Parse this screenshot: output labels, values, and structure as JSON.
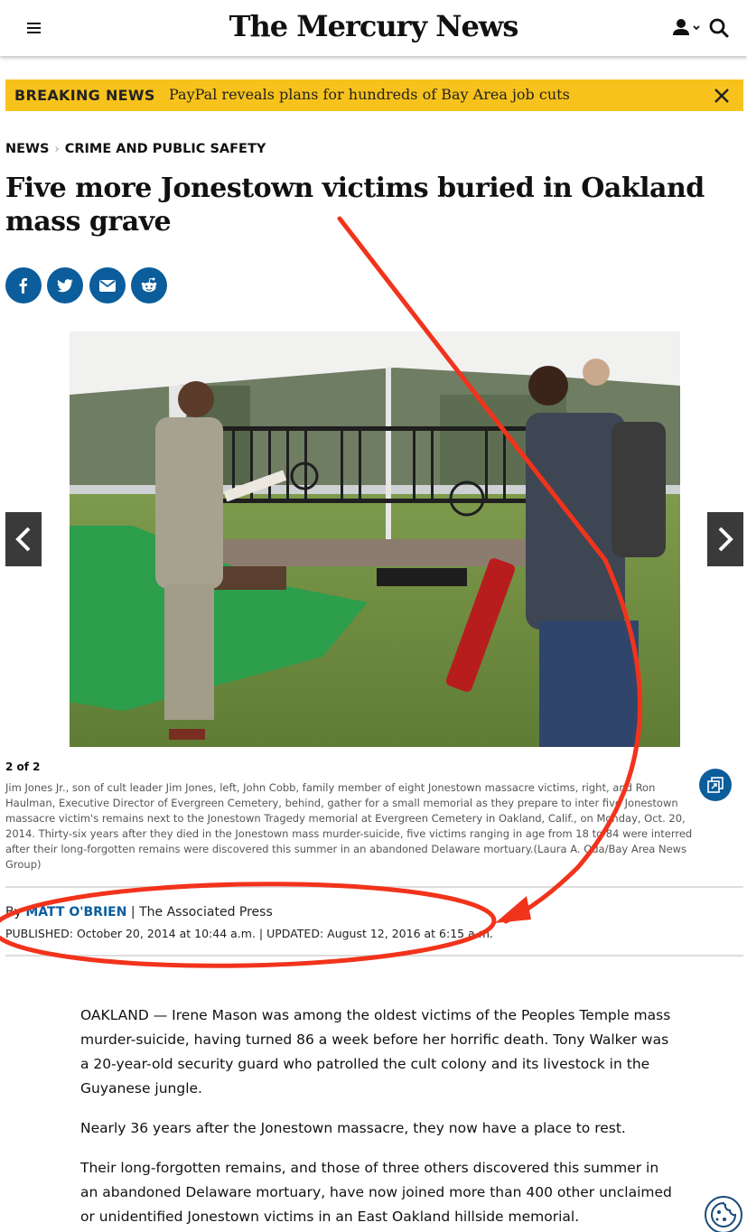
{
  "header": {
    "logo": "The Mercury News"
  },
  "breaking": {
    "label": "BREAKING NEWS",
    "text": "PayPal reveals plans for hundreds of Bay Area job cuts",
    "color": "#f7c21b"
  },
  "breadcrumb": {
    "items": [
      "NEWS",
      "CRIME AND PUBLIC SAFETY"
    ]
  },
  "article": {
    "headline": "Five more Jonestown victims buried in Oakland mass grave",
    "share_icons": [
      "facebook-icon",
      "twitter-icon",
      "email-icon",
      "reddit-icon"
    ],
    "gallery": {
      "counter": "2 of 2",
      "caption": "Jim Jones Jr., son of cult leader Jim Jones, left, John Cobb, family member of eight Jonestown massacre victims, right, and Ron Haulman, Executive Director of Evergreen Cemetery, behind, gather for a small memorial as they prepare to inter five Jonestown massacre victim's remains next to the Jonestown Tragedy memorial at Evergreen Cemetery in Oakland, Calif., on Monday, Oct. 20, 2014. Thirty-six years after they died in the Jonestown mass murder-suicide, five victims ranging in age from 18 to 84 were interred after their long-forgotten remains were discovered this summer in an abandoned Delaware mortuary.(Laura A. Oda/Bay Area News Group)"
    },
    "byline": {
      "prefix": "By",
      "author": "MATT O'BRIEN",
      "separator": "|",
      "org": "The Associated Press"
    },
    "dates": {
      "published_label": "PUBLISHED:",
      "published": "October 20, 2014 at 10:44 a.m.",
      "separator": "|",
      "updated_label": "UPDATED:",
      "updated": "August 12, 2016 at 6:15 a.m."
    },
    "paragraphs": [
      "OAKLAND — Irene Mason was among the oldest victims of the Peoples Temple mass murder-suicide, having turned 86 a week before her horrific death. Tony Walker was a 20-year-old security guard who patrolled the cult colony and its livestock in the Guyanese jungle.",
      "Nearly 36 years after the Jonestown massacre, they now have a place to rest.",
      "Their long-forgotten remains, and those of three others discovered this summer in an abandoned Delaware mortuary, have now joined more than 400 other unclaimed or unidentified Jonestown victims in an East Oakland hillside memorial."
    ]
  },
  "colors": {
    "brand_blue": "#0b5d9c",
    "annotation_red": "#f2331c"
  }
}
